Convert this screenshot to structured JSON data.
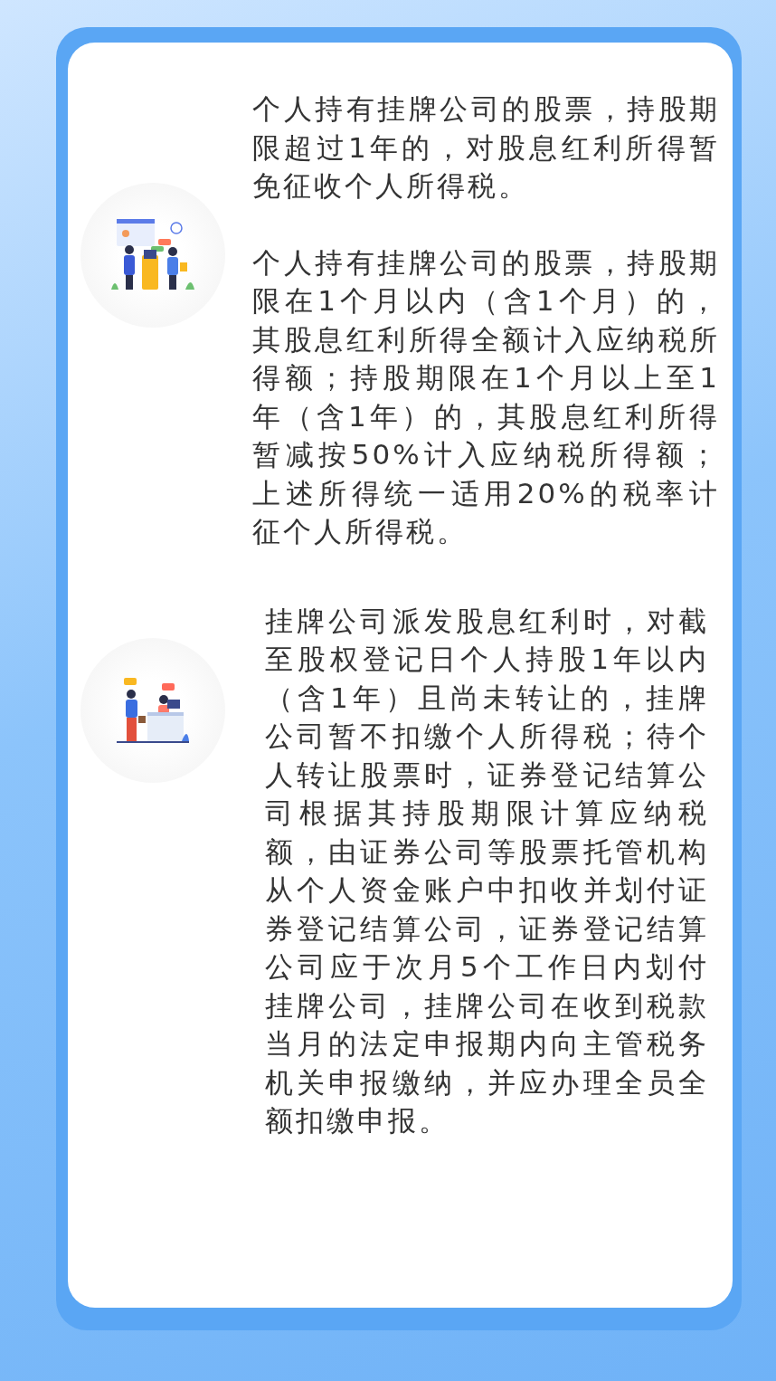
{
  "sections": [
    {
      "kind": "kiosk",
      "paragraphs": [
        "个人持有挂牌公司的股票，持股期限超过1年的，对股息红利所得暂免征收个人所得税。",
        "个人持有挂牌公司的股票，持股期限在1个月以内（含1个月）的，其股息红利所得全额计入应纳税所得额；持股期限在1个月以上至1年（含1年）的，其股息红利所得暂减按50%计入应纳税所得额；上述所得统一适用20%的税率计征个人所得税。"
      ]
    },
    {
      "kind": "counter",
      "paragraphs": [
        "挂牌公司派发股息红利时，对截至股权登记日个人持股1年以内（含1年）且尚未转让的，挂牌公司暂不扣缴个人所得税；待个人转让股票时，证券登记结算公司根据其持股期限计算应纳税额，由证券公司等股票托管机构从个人资金账户中扣收并划付证券登记结算公司，证券登记结算公司应于次月5个工作日内划付挂牌公司，挂牌公司在收到税款当月的法定申报期内向主管税务机关申报缴纳，并应办理全员全额扣缴申报。"
      ]
    }
  ]
}
